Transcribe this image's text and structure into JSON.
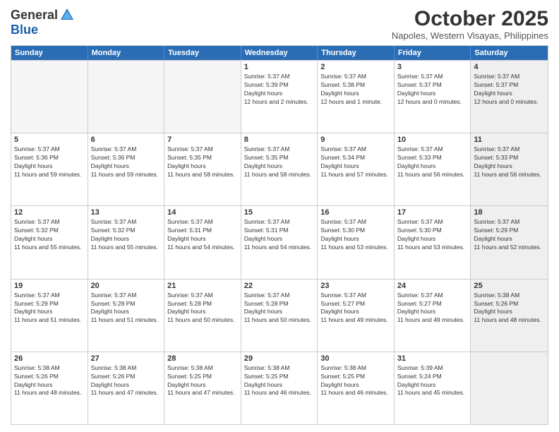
{
  "header": {
    "logo_general": "General",
    "logo_blue": "Blue",
    "month_title": "October 2025",
    "location": "Napoles, Western Visayas, Philippines"
  },
  "days_of_week": [
    "Sunday",
    "Monday",
    "Tuesday",
    "Wednesday",
    "Thursday",
    "Friday",
    "Saturday"
  ],
  "weeks": [
    [
      {
        "day": "",
        "empty": true
      },
      {
        "day": "",
        "empty": true
      },
      {
        "day": "",
        "empty": true
      },
      {
        "day": "1",
        "sunrise": "5:37 AM",
        "sunset": "5:39 PM",
        "daylight": "12 hours and 2 minutes."
      },
      {
        "day": "2",
        "sunrise": "5:37 AM",
        "sunset": "5:38 PM",
        "daylight": "12 hours and 1 minute."
      },
      {
        "day": "3",
        "sunrise": "5:37 AM",
        "sunset": "5:37 PM",
        "daylight": "12 hours and 0 minutes."
      },
      {
        "day": "4",
        "sunrise": "5:37 AM",
        "sunset": "5:37 PM",
        "daylight": "12 hours and 0 minutes.",
        "shaded": true
      }
    ],
    [
      {
        "day": "5",
        "sunrise": "5:37 AM",
        "sunset": "5:36 PM",
        "daylight": "11 hours and 59 minutes."
      },
      {
        "day": "6",
        "sunrise": "5:37 AM",
        "sunset": "5:36 PM",
        "daylight": "11 hours and 59 minutes."
      },
      {
        "day": "7",
        "sunrise": "5:37 AM",
        "sunset": "5:35 PM",
        "daylight": "11 hours and 58 minutes."
      },
      {
        "day": "8",
        "sunrise": "5:37 AM",
        "sunset": "5:35 PM",
        "daylight": "11 hours and 58 minutes."
      },
      {
        "day": "9",
        "sunrise": "5:37 AM",
        "sunset": "5:34 PM",
        "daylight": "11 hours and 57 minutes."
      },
      {
        "day": "10",
        "sunrise": "5:37 AM",
        "sunset": "5:33 PM",
        "daylight": "11 hours and 56 minutes."
      },
      {
        "day": "11",
        "sunrise": "5:37 AM",
        "sunset": "5:33 PM",
        "daylight": "11 hours and 56 minutes.",
        "shaded": true
      }
    ],
    [
      {
        "day": "12",
        "sunrise": "5:37 AM",
        "sunset": "5:32 PM",
        "daylight": "11 hours and 55 minutes."
      },
      {
        "day": "13",
        "sunrise": "5:37 AM",
        "sunset": "5:32 PM",
        "daylight": "11 hours and 55 minutes."
      },
      {
        "day": "14",
        "sunrise": "5:37 AM",
        "sunset": "5:31 PM",
        "daylight": "11 hours and 54 minutes."
      },
      {
        "day": "15",
        "sunrise": "5:37 AM",
        "sunset": "5:31 PM",
        "daylight": "11 hours and 54 minutes."
      },
      {
        "day": "16",
        "sunrise": "5:37 AM",
        "sunset": "5:30 PM",
        "daylight": "11 hours and 53 minutes."
      },
      {
        "day": "17",
        "sunrise": "5:37 AM",
        "sunset": "5:30 PM",
        "daylight": "11 hours and 53 minutes."
      },
      {
        "day": "18",
        "sunrise": "5:37 AM",
        "sunset": "5:29 PM",
        "daylight": "11 hours and 52 minutes.",
        "shaded": true
      }
    ],
    [
      {
        "day": "19",
        "sunrise": "5:37 AM",
        "sunset": "5:29 PM",
        "daylight": "11 hours and 51 minutes."
      },
      {
        "day": "20",
        "sunrise": "5:37 AM",
        "sunset": "5:28 PM",
        "daylight": "11 hours and 51 minutes."
      },
      {
        "day": "21",
        "sunrise": "5:37 AM",
        "sunset": "5:28 PM",
        "daylight": "11 hours and 50 minutes."
      },
      {
        "day": "22",
        "sunrise": "5:37 AM",
        "sunset": "5:28 PM",
        "daylight": "11 hours and 50 minutes."
      },
      {
        "day": "23",
        "sunrise": "5:37 AM",
        "sunset": "5:27 PM",
        "daylight": "11 hours and 49 minutes."
      },
      {
        "day": "24",
        "sunrise": "5:37 AM",
        "sunset": "5:27 PM",
        "daylight": "11 hours and 49 minutes."
      },
      {
        "day": "25",
        "sunrise": "5:38 AM",
        "sunset": "5:26 PM",
        "daylight": "11 hours and 48 minutes.",
        "shaded": true
      }
    ],
    [
      {
        "day": "26",
        "sunrise": "5:38 AM",
        "sunset": "5:26 PM",
        "daylight": "11 hours and 48 minutes."
      },
      {
        "day": "27",
        "sunrise": "5:38 AM",
        "sunset": "5:26 PM",
        "daylight": "11 hours and 47 minutes."
      },
      {
        "day": "28",
        "sunrise": "5:38 AM",
        "sunset": "5:25 PM",
        "daylight": "11 hours and 47 minutes."
      },
      {
        "day": "29",
        "sunrise": "5:38 AM",
        "sunset": "5:25 PM",
        "daylight": "11 hours and 46 minutes."
      },
      {
        "day": "30",
        "sunrise": "5:38 AM",
        "sunset": "5:25 PM",
        "daylight": "11 hours and 46 minutes."
      },
      {
        "day": "31",
        "sunrise": "5:39 AM",
        "sunset": "5:24 PM",
        "daylight": "11 hours and 45 minutes."
      },
      {
        "day": "",
        "empty": true,
        "shaded": true
      }
    ]
  ],
  "labels": {
    "sunrise": "Sunrise:",
    "sunset": "Sunset:",
    "daylight": "Daylight hours"
  }
}
